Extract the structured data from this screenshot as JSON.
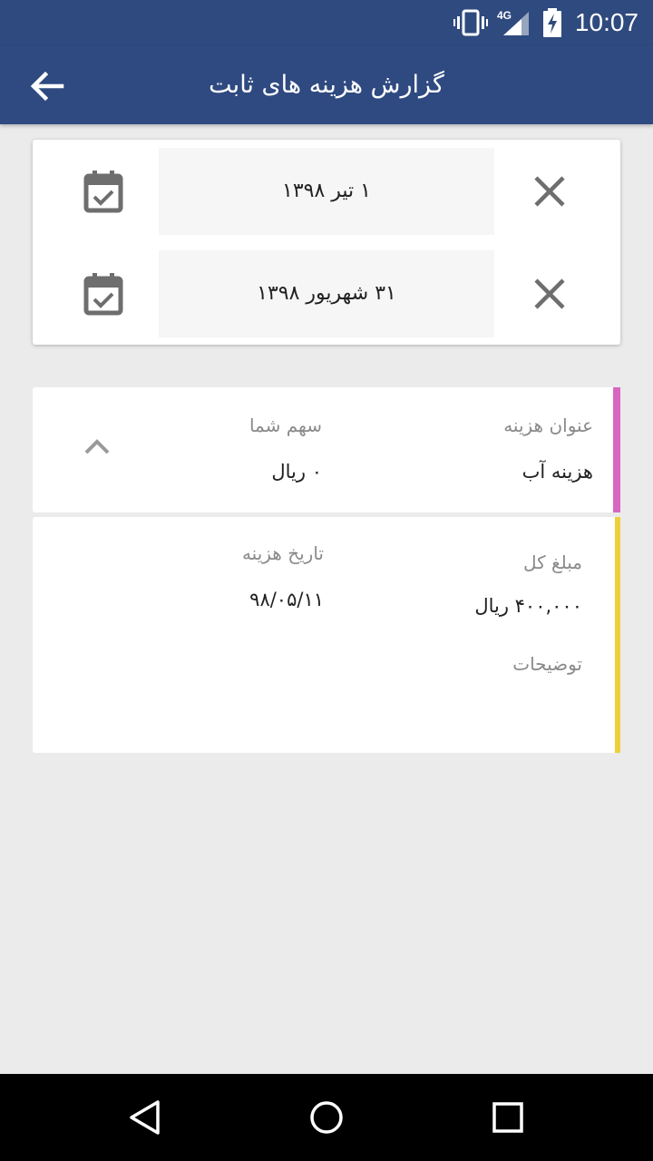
{
  "status_bar": {
    "time": "10:07",
    "network": "4G",
    "icons": [
      "vibrate-icon",
      "signal-icon",
      "battery-charging-icon"
    ]
  },
  "app_bar": {
    "title": "گزارش هزینه های ثابت",
    "back_icon": "arrow-back-icon"
  },
  "date_filter": {
    "from_date": "۱ تیر ۱۳۹۸",
    "to_date": "۳۱ شهریور ۱۳۹۸",
    "icons": [
      "calendar-check-icon",
      "close-icon"
    ]
  },
  "expense": {
    "title_label": "عنوان هزینه",
    "title_value": "هزینه آب",
    "share_label": "سهم شما",
    "share_value": "۰ ریال",
    "total_label": "مبلغ کل",
    "total_value": "۴۰۰,۰۰۰ ریال",
    "date_label": "تاریخ هزینه",
    "date_value": "۹۸/۰۵/۱۱",
    "description_label": "توضیحات",
    "accent_head": "#d966c0",
    "accent_detail": "#eecf3a"
  },
  "colors": {
    "primary": "#2f4a81",
    "background": "#ebebeb"
  },
  "nav_bar": {
    "icons": [
      "back-triangle-icon",
      "home-circle-icon",
      "recents-square-icon"
    ]
  }
}
